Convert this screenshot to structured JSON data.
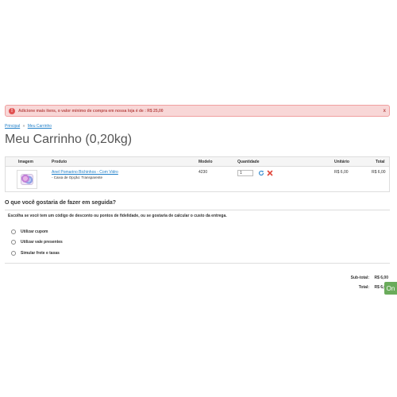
{
  "alert": {
    "message": "Adicione mais itens, o valor mínimo de compra em nossa loja é de : R$ 25,00",
    "close": "x"
  },
  "breadcrumb": {
    "home": "Principal",
    "separator": "»",
    "current": "Meu Carrinho"
  },
  "page": {
    "title": "Meu Carrinho  (0,20kg)"
  },
  "cart": {
    "headers": {
      "image": "Imagem",
      "product": "Produto",
      "model": "Modelo",
      "quantity": "Quantidade",
      "unit": "Unitário",
      "total": "Total"
    },
    "items": [
      {
        "name": "Anel Pomarino Bichinhos - Com Vidro",
        "option": "- Caixa de Opção: Transparente",
        "model": "4230",
        "quantity": "1",
        "unit_price": "R$ 6,00",
        "total_price": "R$ 6,00"
      }
    ]
  },
  "next": {
    "title": "O que você gostaria de fazer em seguida?",
    "intro": "Escolha se você tem um código de desconto ou pontos de fidelidade, ou se gostaria de calcular o custo da entrega.",
    "options": [
      "Utilizar cupom",
      "Utilizar vale presentes",
      "Simular frete e taxas"
    ]
  },
  "totals": {
    "subtotal_label": "Sub-total:",
    "subtotal_value": "R$ 6,00",
    "total_label": "Total:",
    "total_value": "R$ 6,00"
  },
  "chat_tab": "On",
  "colors": {
    "link": "#1e7ec8",
    "alert_bg": "#f8d7d7",
    "alert_text": "#b94a48",
    "chat_green": "#6aab5b"
  }
}
